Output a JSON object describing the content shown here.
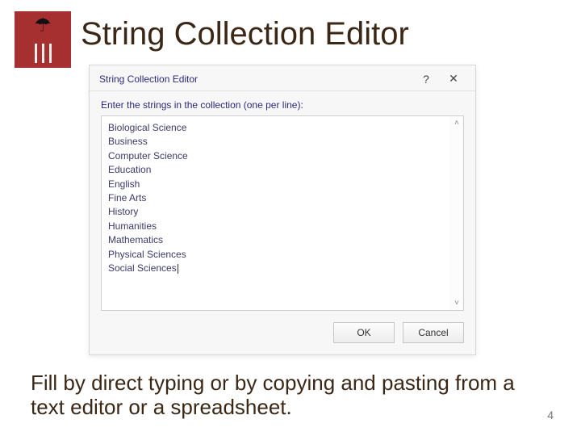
{
  "slide": {
    "title": "String Collection Editor",
    "logo_icon": "umbrella-icon",
    "caption": "Fill by direct typing or by copying and pasting from a text editor or a spreadsheet.",
    "page_number": "4"
  },
  "dialog": {
    "title": "String Collection Editor",
    "help_label": "?",
    "close_label": "✕",
    "instruction": "Enter the strings in the collection (one per line):",
    "items": [
      "Biological Science",
      "Business",
      "Computer Science",
      "Education",
      "English",
      "Fine Arts",
      "History",
      "Humanities",
      "Mathematics",
      "Physical Sciences",
      "Social Sciences"
    ],
    "scroll_up": "˄",
    "scroll_down": "˅",
    "ok_label": "OK",
    "cancel_label": "Cancel"
  }
}
